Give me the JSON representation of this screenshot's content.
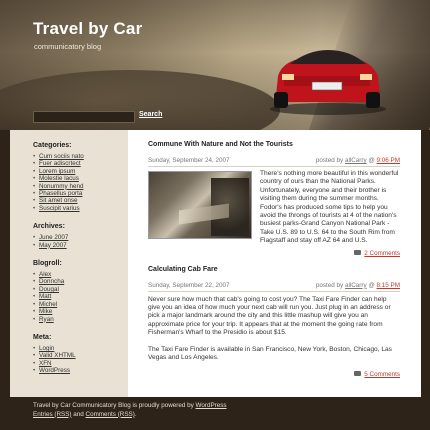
{
  "header": {
    "title": "Travel by Car",
    "tagline": "communicatory blog"
  },
  "search": {
    "placeholder": "",
    "button_label": "Search"
  },
  "sidebar": {
    "categories": {
      "heading": "Categories:",
      "items": [
        "Cum sociis nato",
        "Fuer adiscrtect",
        "Lorem ipsum",
        "Molestie lacus",
        "Nonummy hend",
        "Phasellus porta",
        "Sit amet onse",
        "Suscipit varius"
      ]
    },
    "archives": {
      "heading": "Archives:",
      "items": [
        "June 2007",
        "May 2007"
      ]
    },
    "blogroll": {
      "heading": "Blogroll:",
      "items": [
        "Alex",
        "Donncha",
        "Dougal",
        "Matt",
        "Michel",
        "Mike",
        "Ryan"
      ]
    },
    "meta": {
      "heading": "Meta:",
      "items": [
        "Login",
        "Valid XHTML",
        "XFN",
        "WordPress"
      ]
    }
  },
  "posts": [
    {
      "title": "Commune With Nature and Not the Tourists",
      "date": "Sunday, September 24, 2007",
      "posted_by": "posted by",
      "author": "allCarry",
      "at": "@",
      "time": "9:06 PM",
      "body": "There's nothing more beautiful in this wonderful country of ours than the National Parks. Unfortunately, everyone and their brother is visiting them during the summer months. Fodor's has produced some tips to help you avoid the throngs of tourists at 4 of the nation's busiest parks-Grand Canyon National Park - Take U.S. 89 to U.S. 64 to the South Rim from Flagstaff and stay off AZ 64 and U.S.",
      "comments": "2 Comments"
    },
    {
      "title": "Calculating Cab Fare",
      "date": "Sunday, September 22, 2007",
      "posted_by": "posted by",
      "author": "allCarry",
      "at": "@",
      "time": "8:15 PM",
      "body_1": "Never sure how much that cab's going to cost you? The Taxi Fare Finder can help give you an idea of how much your next cab will run you. Just plug in an address or pick a major landmark around the city and this little mashup will give you an approximate price for your trip. It appears that at the moment the going rate from Fisherman's Wharf to the Presidio is about $15.",
      "body_2": "The Taxi Fare Finder is available in San Francisco, New York, Boston, Chicago, Las Vegas and Los Angeles.",
      "comments": "5 Comments"
    }
  ],
  "footer": {
    "line1_text": "Travel by Car Communicatory Blog is proudly powered by",
    "line1_link": "WordPress",
    "line2_link1": "Entries (RSS)",
    "line2_and": "and",
    "line2_link2": "Comments (RSS)",
    "line2_end": "."
  }
}
